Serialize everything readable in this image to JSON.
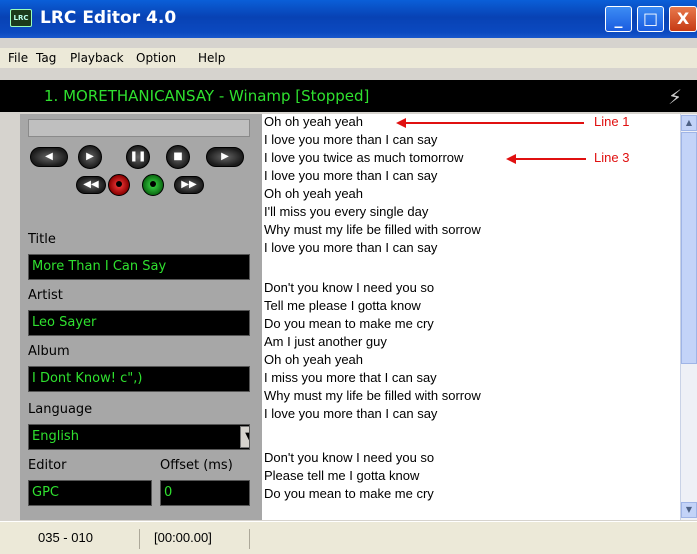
{
  "window": {
    "title": "LRC Editor 4.0",
    "controls": {
      "minimize": "_",
      "maximize": "□",
      "close": "X"
    }
  },
  "menu": [
    "File",
    "Tag",
    "Playback",
    "Option",
    "Help"
  ],
  "now_playing": "1. MORETHANICANSAY - Winamp [Stopped]",
  "player": {
    "buttons_row1": [
      "prev-icon",
      "play-icon",
      "pause-icon",
      "stop-icon",
      "next-icon"
    ],
    "buttons_row2": [
      "rewind-icon",
      "record-icon",
      "check-icon",
      "forward-icon"
    ]
  },
  "tags": {
    "title_label": "Title",
    "title_value": "More Than I Can Say",
    "artist_label": "Artist",
    "artist_value": "Leo Sayer",
    "album_label": "Album",
    "album_value": "I Dont Know! c\",)",
    "language_label": "Language",
    "language_value": "English",
    "editor_label": "Editor",
    "editor_value": "GPC",
    "offset_label": "Offset (ms)",
    "offset_value": "0"
  },
  "lyrics": [
    "Oh oh yeah yeah",
    "I love you more than I can say",
    "I love you twice as much tomorrow",
    "I love you more than I can say",
    "Oh oh yeah yeah",
    "I'll miss you every single day",
    "Why must my life be filled with sorrow",
    "I love you more than I can say",
    "",
    "Don't you know I need you so",
    "Tell me please I gotta know",
    "Do you mean to make me cry",
    "Am I just another guy",
    "Oh oh yeah yeah",
    "I miss you more that I can say",
    "Why must my life be filled with sorrow",
    "I love you more than I can say",
    "",
    "Don't you know I need you so",
    "Please tell me I gotta know",
    "Do you mean to make me cry"
  ],
  "annotations": {
    "line1": "Line 1",
    "line3": "Line 3"
  },
  "colors": {
    "accent_green": "#2fe02f",
    "annotation_red": "#e01010",
    "titlebar_blue": "#0842b4"
  },
  "status": {
    "position": "035 - 010",
    "time": "[00:00.00]"
  }
}
